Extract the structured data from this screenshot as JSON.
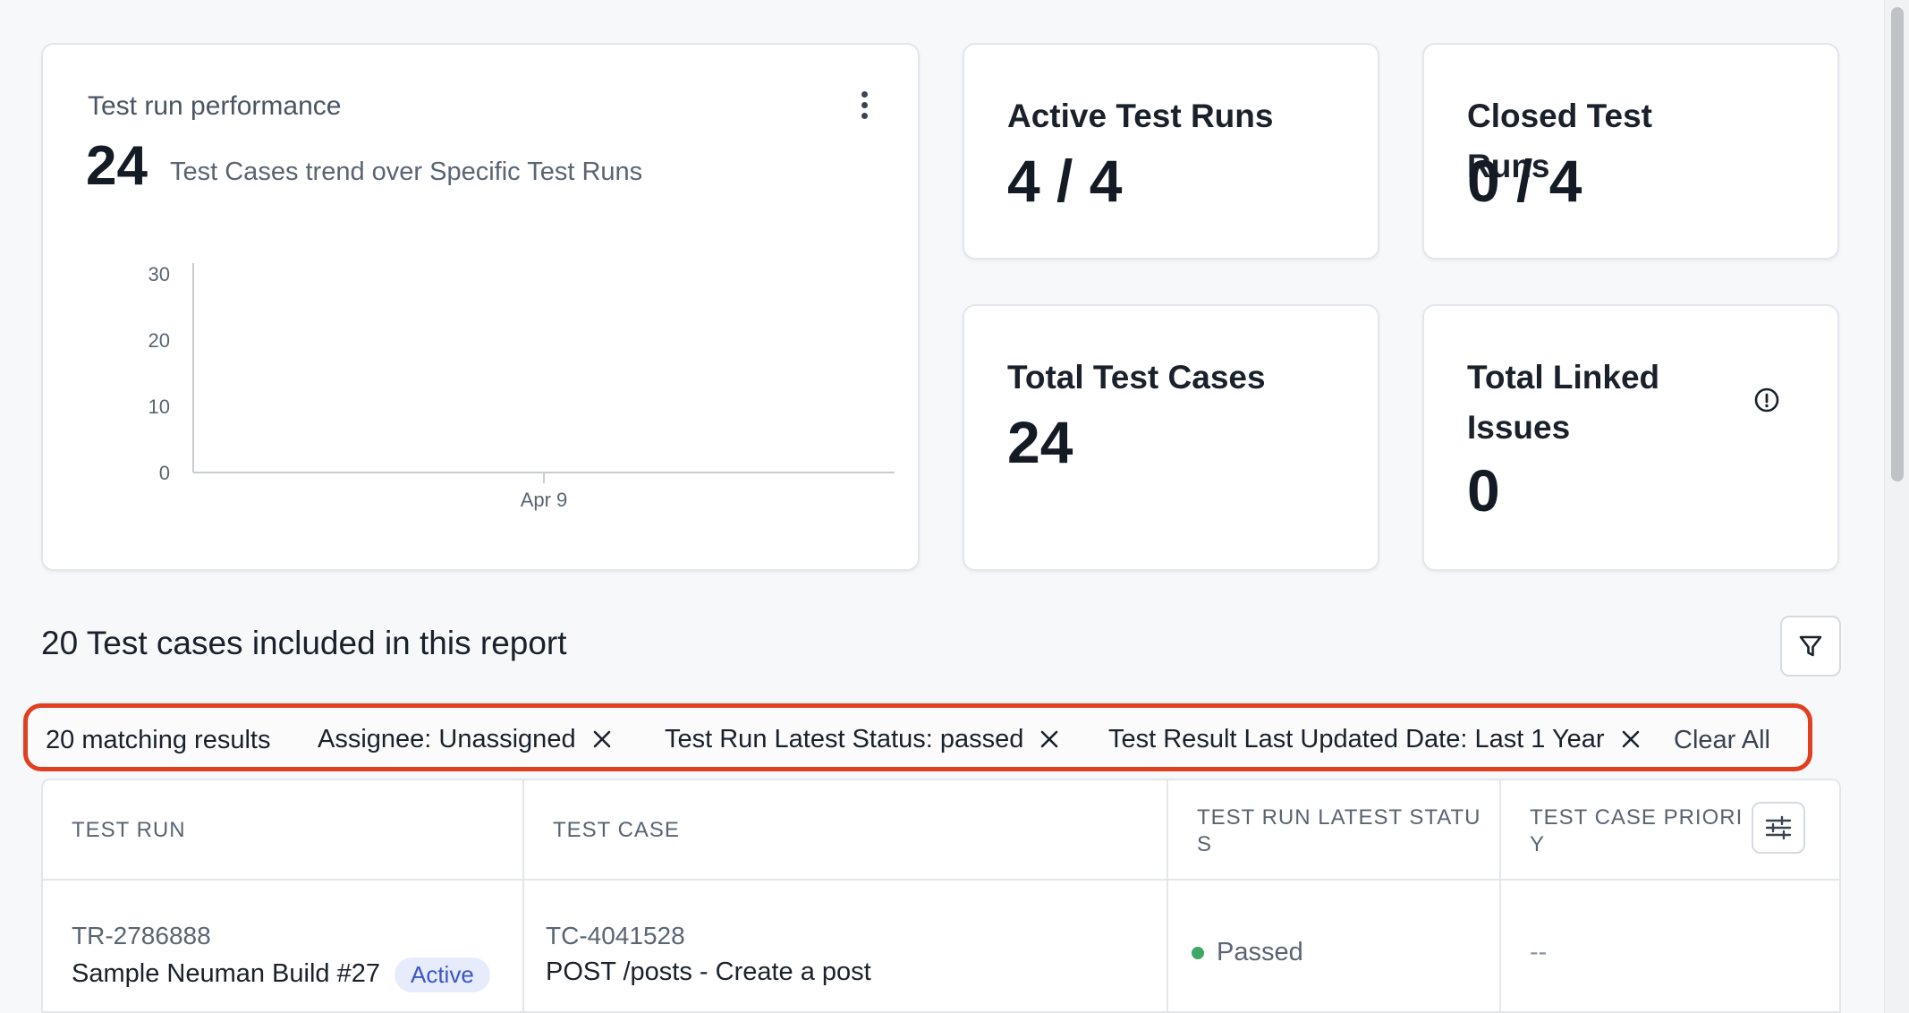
{
  "performance": {
    "title": "Test run performance",
    "count": "24",
    "subtitle": "Test Cases trend over Specific Test Runs",
    "menu_icon": "kebab-icon"
  },
  "chart_data": {
    "type": "line",
    "title": "",
    "xlabel": "",
    "ylabel": "",
    "categories": [
      "Apr 9"
    ],
    "x_ticks": [
      "Apr 9"
    ],
    "y_ticks": [
      "0",
      "10",
      "20",
      "30"
    ],
    "ylim": [
      0,
      30
    ],
    "series": [],
    "grid": false
  },
  "stats": {
    "active": {
      "title": "Active Test Runs",
      "value": "4 / 4"
    },
    "closed": {
      "title": "Closed Test Runs",
      "value": "0 / 4"
    },
    "total_cases": {
      "title": "Total Test Cases",
      "value": "24"
    },
    "linked": {
      "title": "Total Linked Issues",
      "value": "0",
      "icon": "info-icon"
    }
  },
  "section": {
    "title": "20 Test cases included in this report",
    "filter_icon": "filter-icon"
  },
  "filters": {
    "match_count": "20 matching results",
    "chips": [
      "Assignee: Unassigned",
      "Test Run Latest Status: passed",
      "Test Result Last Updated Date: Last 1 Year"
    ],
    "clear_all": "Clear All",
    "accent_color": "#e0401f"
  },
  "table": {
    "headers": {
      "test_run": "TEST RUN",
      "test_case": "TEST CASE",
      "status_line1": "TEST RUN LATEST STATU",
      "status_line2": "S",
      "priority_line1": "TEST CASE PRIORI",
      "priority_line2": "Y"
    },
    "rows": [
      {
        "run_id": "TR-2786888",
        "run_name": "Sample Neuman Build #27",
        "run_badge": "Active",
        "case_id": "TC-4041528",
        "case_name": "POST /posts - Create a post",
        "status": "Passed",
        "priority": "--"
      }
    ]
  }
}
